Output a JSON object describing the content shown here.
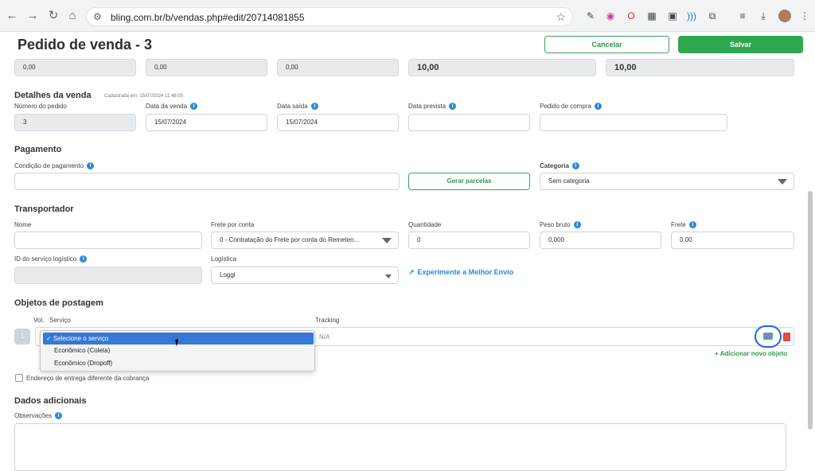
{
  "browser": {
    "url": "bling.com.br/b/vendas.php#edit/20714081855"
  },
  "header": {
    "title": "Pedido de venda - 3",
    "cancel_label": "Cancelar",
    "save_label": "Salvar"
  },
  "totals": {
    "values": [
      "0,00",
      "0,00",
      "0,00",
      "10,00",
      "10,00"
    ]
  },
  "detalhes": {
    "title": "Detalhes da venda",
    "cadastrada": "Cadastrada em: 15/07/2024 11:48:05",
    "numero_label": "Número do pedido",
    "numero_value": "3",
    "data_venda_label": "Data da venda",
    "data_venda_value": "15/07/2024",
    "data_saida_label": "Data saída",
    "data_saida_value": "15/07/2024",
    "data_prevista_label": "Data prevista",
    "pedido_compra_label": "Pedido de compra"
  },
  "pagamento": {
    "title": "Pagamento",
    "condicao_label": "Condição de pagamento",
    "gerar_label": "Gerar parcelas",
    "categoria_label": "Categoria",
    "categoria_value": "Sem categoria"
  },
  "transportador": {
    "title": "Transportador",
    "nome_label": "Nome",
    "frete_conta_label": "Frete por conta",
    "frete_conta_value": "0 - Contratação do Frete por conta do Remeten...",
    "quantidade_label": "Quantidade",
    "quantidade_value": "0",
    "peso_label": "Peso bruto",
    "peso_value": "0,000",
    "frete_label": "Frete",
    "frete_value": "0,00",
    "id_servico_label": "ID do serviço logístico",
    "logistica_label": "Logística",
    "logistica_value": "Loggi",
    "melhor_envio_label": "Experimente a Melhor Envio"
  },
  "objetos": {
    "title": "Objetos de postagem",
    "vol_label": "Vol.",
    "servico_label": "Serviço",
    "tracking_label": "Tracking",
    "vol_value": "1",
    "tracking_value": "N/A",
    "dropdown_options": [
      "✓ Selecione o serviço",
      "Econômico (Coleta)",
      "Econômico (Dropoff)"
    ],
    "add_label": "+ Adicionar novo objeto",
    "endereco_label": "Endereço de entrega diferente da cobrança"
  },
  "adicionais": {
    "title": "Dados adicionais",
    "observacoes_label": "Observações"
  },
  "colors": {
    "primary_green": "#2fa74e",
    "link_blue": "#2a8ad8",
    "highlight_blue": "#1a66e0",
    "delete_red": "#e24a4a"
  }
}
